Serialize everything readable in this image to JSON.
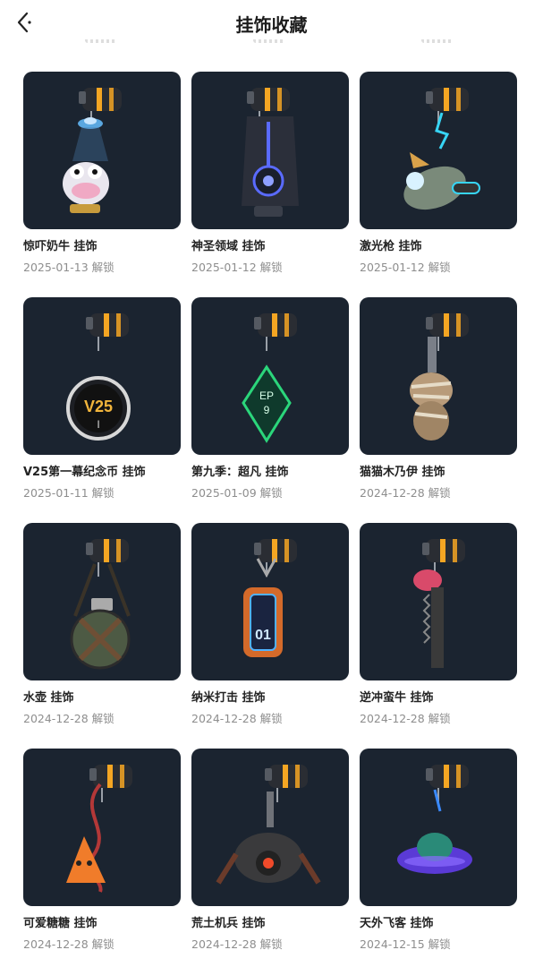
{
  "header": {
    "title": "挂饰收藏",
    "back_icon": "chevron-left-icon"
  },
  "items": [
    {
      "name": "惊吓奶牛 挂饰",
      "date": "2025-01-13 解锁",
      "art": "cow"
    },
    {
      "name": "神圣领域 挂饰",
      "date": "2025-01-12 解锁",
      "art": "holy"
    },
    {
      "name": "激光枪 挂饰",
      "date": "2025-01-12 解锁",
      "art": "laser"
    },
    {
      "name": "V25第一幕纪念币 挂饰",
      "date": "2025-01-11 解锁",
      "art": "coin"
    },
    {
      "name": "第九季：超凡 挂饰",
      "date": "2025-01-09 解锁",
      "art": "ep9"
    },
    {
      "name": "猫猫木乃伊 挂饰",
      "date": "2024-12-28 解锁",
      "art": "mummy"
    },
    {
      "name": "水壶 挂饰",
      "date": "2024-12-28 解锁",
      "art": "canteen"
    },
    {
      "name": "纳米打击 挂饰",
      "date": "2024-12-28 解锁",
      "art": "nano"
    },
    {
      "name": "逆冲蛮牛 挂饰",
      "date": "2024-12-28 解锁",
      "art": "chainsaw"
    },
    {
      "name": "可爱糖糖 挂饰",
      "date": "2024-12-28 解锁",
      "art": "candy"
    },
    {
      "name": "荒土机兵 挂饰",
      "date": "2024-12-28 解锁",
      "art": "robot"
    },
    {
      "name": "天外飞客 挂饰",
      "date": "2024-12-15 解锁",
      "art": "ufo"
    }
  ],
  "art_labels": {
    "coin": "V25",
    "coin_sub": "I",
    "ep9_top": "EP",
    "ep9_num": "9",
    "nano": "01"
  },
  "colors": {
    "card_bg": "#1b2430",
    "accent": "#f5a623",
    "text": "#232323",
    "subtext": "#8e8e8e"
  }
}
